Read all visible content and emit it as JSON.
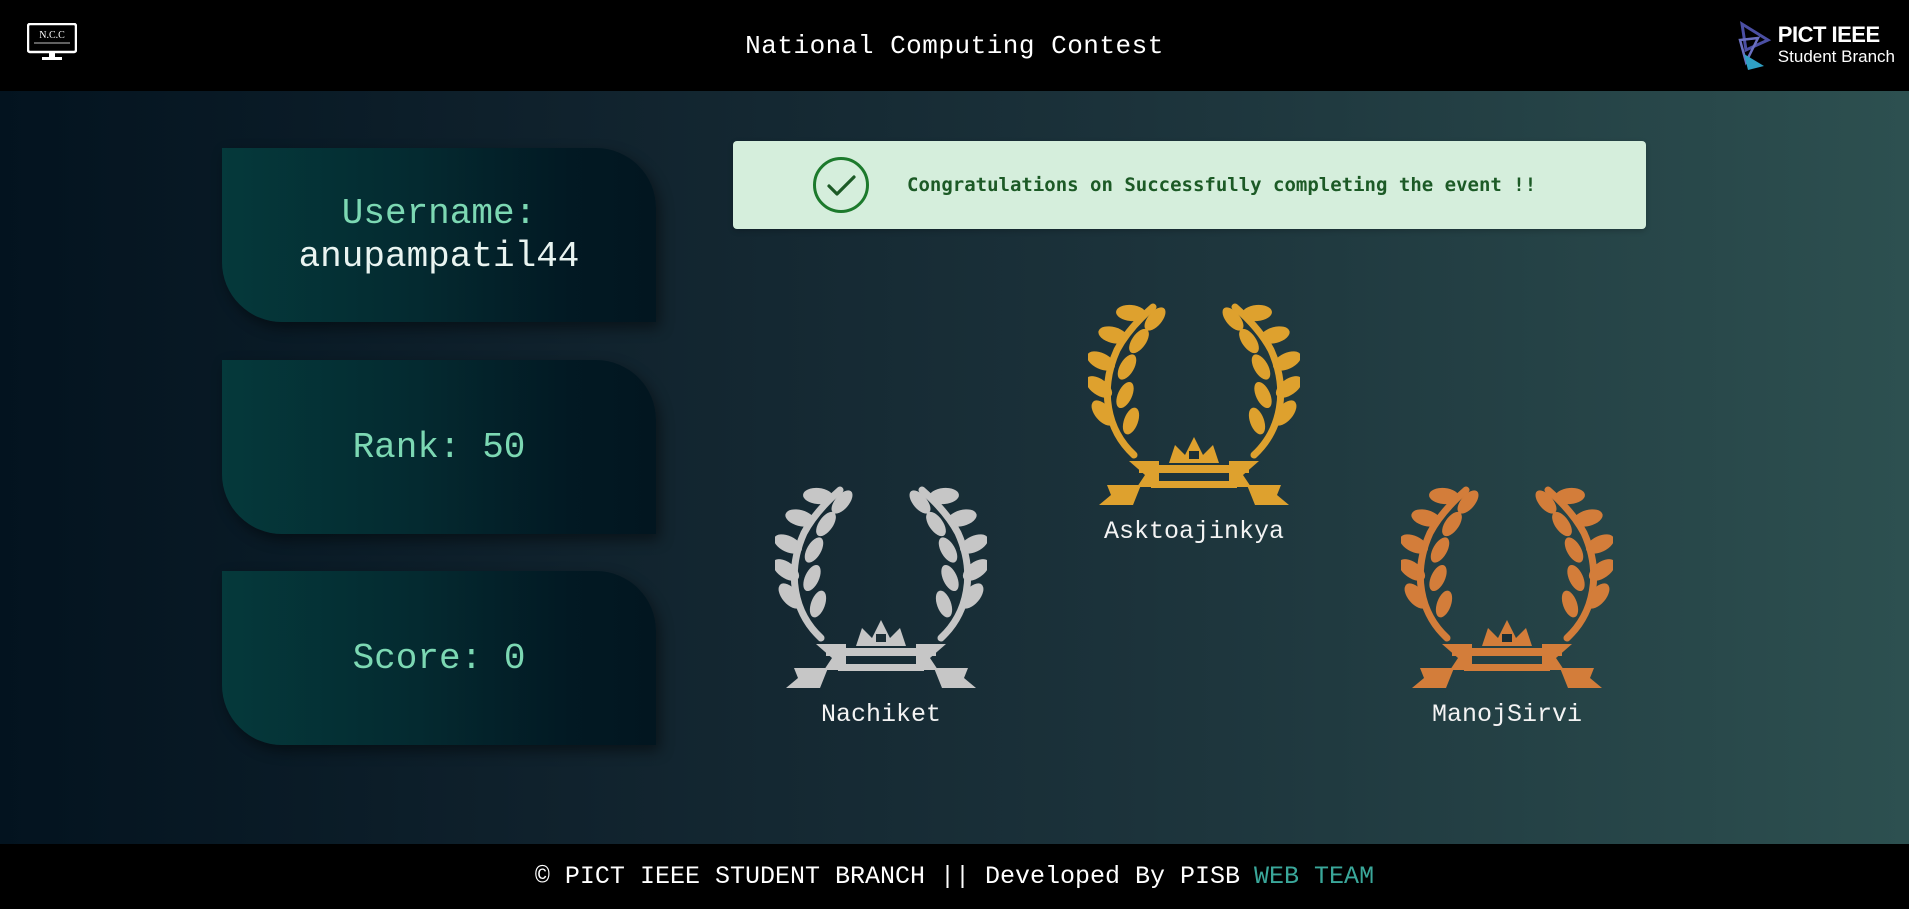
{
  "header": {
    "title": "National Computing Contest",
    "left_logo_text": "N.C.C",
    "right_logo": {
      "line1": "PICT IEEE",
      "line2": "Student Branch"
    }
  },
  "profile": {
    "username_label": "Username:",
    "username": "anupampatil44",
    "rank_label": "Rank:",
    "rank": "50",
    "score_label": "Score:",
    "score": "0"
  },
  "alert": {
    "message": "Congratulations on Successfully completing the event !!",
    "icon": "check-circle-icon"
  },
  "leaderboard": {
    "first": {
      "name": "Asktoajinkya",
      "color": "#dea12e"
    },
    "second": {
      "name": "Nachiket",
      "color": "#c6c6c6"
    },
    "third": {
      "name": "ManojSirvi",
      "color": "#d37d3a"
    }
  },
  "footer": {
    "text": "© PICT IEEE STUDENT BRANCH || Developed By PISB",
    "team": "WEB TEAM",
    "team_color": "#3aa79a"
  }
}
